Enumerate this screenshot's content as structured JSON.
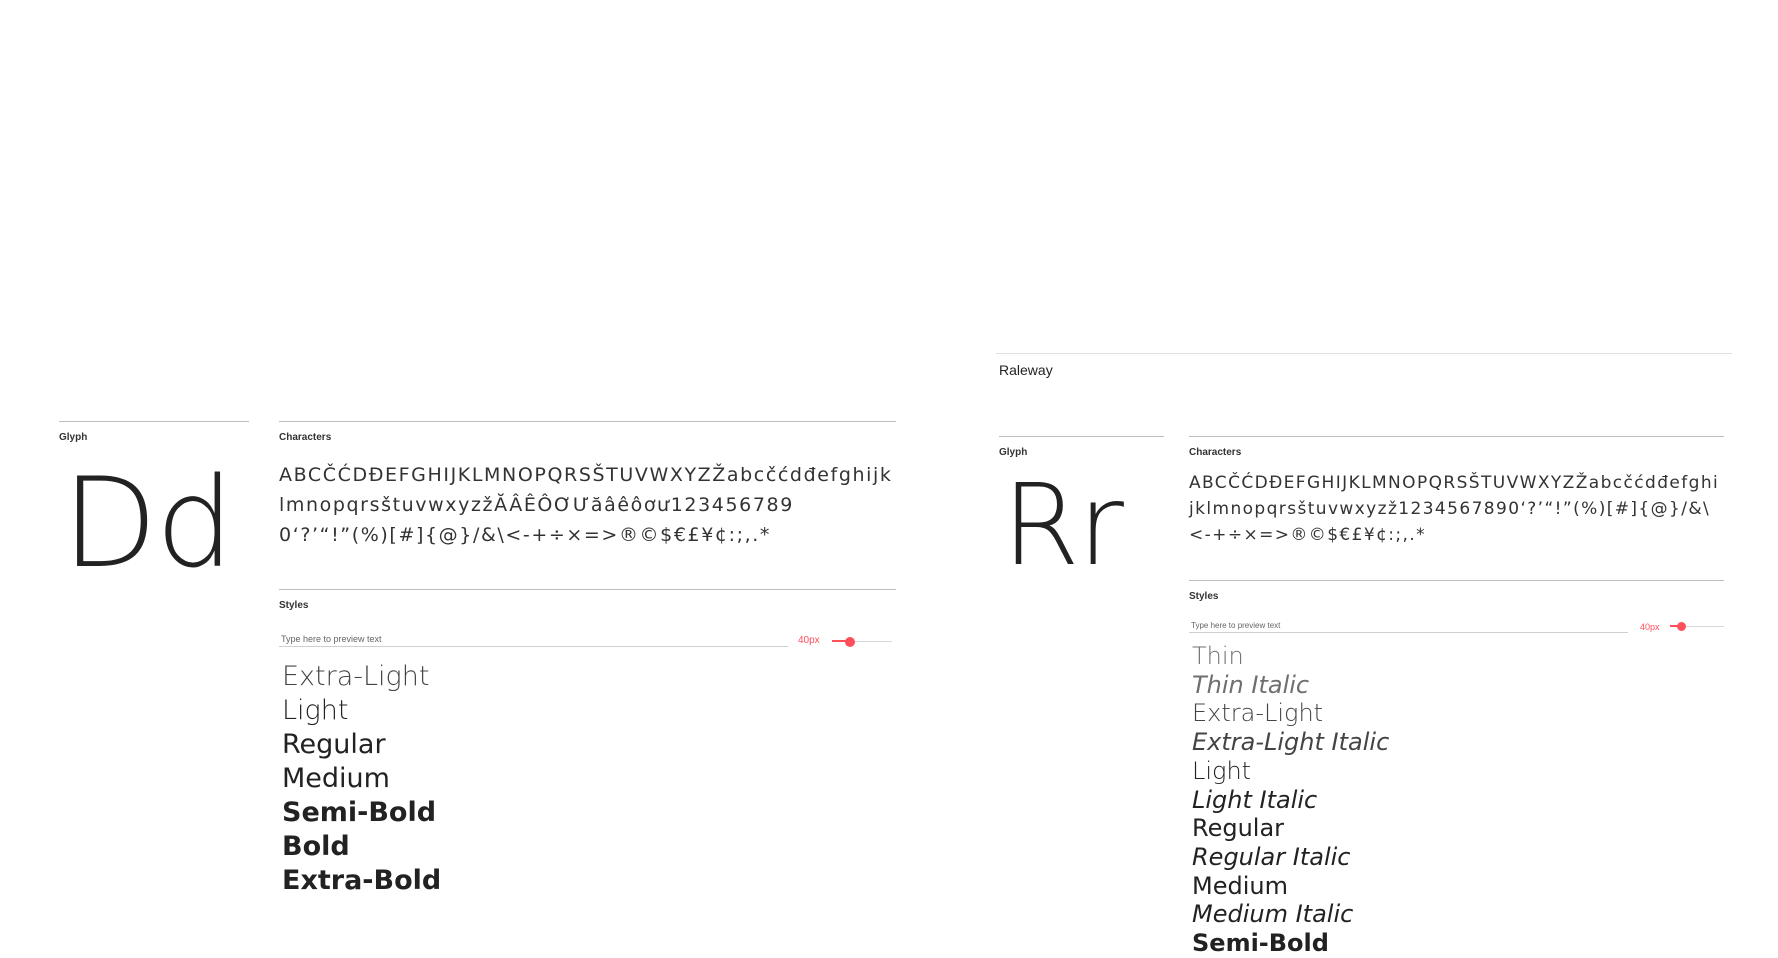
{
  "left_card": {
    "glyph_label": "Glyph",
    "glyph": "Dd",
    "characters_label": "Characters",
    "characters": "ABCČĆDĐEFGHIJKLMNOPQRSŠTUVWXYZŽabcčćdđefghijklmnopqrsštuvwxyzžĂÂÊÔƠƯăâêôơư1234567890‘?’“!”(%)[#]{@}/&\\<-+÷×=>®©$€£¥¢:;,.*",
    "styles_label": "Styles",
    "preview_placeholder": "Type here to preview text",
    "size_value": "40px",
    "size_fraction": 0.3,
    "styles": [
      {
        "label": "Extra-Light",
        "weight": 200,
        "italic": false
      },
      {
        "label": "Light",
        "weight": 300,
        "italic": false
      },
      {
        "label": "Regular",
        "weight": 400,
        "italic": false
      },
      {
        "label": "Medium",
        "weight": 500,
        "italic": false
      },
      {
        "label": "Semi-Bold",
        "weight": 600,
        "italic": false
      },
      {
        "label": "Bold",
        "weight": 700,
        "italic": false
      },
      {
        "label": "Extra-Bold",
        "weight": 800,
        "italic": false
      }
    ]
  },
  "right_card": {
    "font_name": "Raleway",
    "glyph_label": "Glyph",
    "glyph": "Rr",
    "characters_label": "Characters",
    "characters": "ABCČĆDĐEFGHIJKLMNOPQRSŠTUVWXYZŽabcčćdđefghijklmnopqrsštuvwxyzž1234567890‘?’“!”(%)[#]{@}/&\\<-+÷×=>®©$€£¥¢:;,.*",
    "styles_label": "Styles",
    "preview_placeholder": "Type here to preview text",
    "size_value": "40px",
    "size_fraction": 0.2,
    "styles": [
      {
        "label": "Thin",
        "weight": 100,
        "italic": false
      },
      {
        "label": "Thin Italic",
        "weight": 100,
        "italic": true
      },
      {
        "label": "Extra-Light",
        "weight": 200,
        "italic": false
      },
      {
        "label": "Extra-Light Italic",
        "weight": 200,
        "italic": true
      },
      {
        "label": "Light",
        "weight": 300,
        "italic": false
      },
      {
        "label": "Light Italic",
        "weight": 300,
        "italic": true
      },
      {
        "label": "Regular",
        "weight": 400,
        "italic": false
      },
      {
        "label": "Regular Italic",
        "weight": 400,
        "italic": true
      },
      {
        "label": "Medium",
        "weight": 500,
        "italic": false
      },
      {
        "label": "Medium Italic",
        "weight": 500,
        "italic": true
      },
      {
        "label": "Semi-Bold",
        "weight": 600,
        "italic": false
      }
    ]
  },
  "colors": {
    "accent": "#ff4f5a",
    "text": "#222222",
    "rule": "#bdbdbd"
  }
}
